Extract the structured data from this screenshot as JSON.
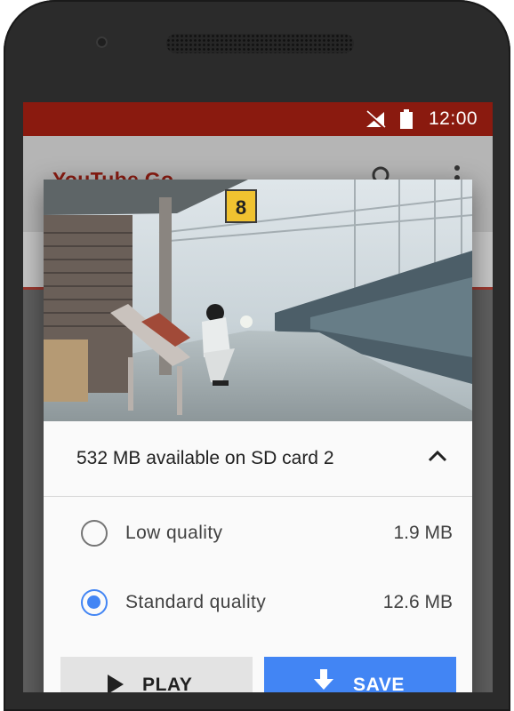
{
  "status_bar": {
    "time": "12:00",
    "icons": [
      "no-signal-icon",
      "battery-icon"
    ]
  },
  "app": {
    "title": "YouTube Go",
    "icons": [
      "search-icon",
      "more-vert-icon"
    ]
  },
  "dialog": {
    "storage_text": "532 MB available on SD card 2",
    "options": [
      {
        "label": "Low quality",
        "size": "1.9 MB",
        "selected": false
      },
      {
        "label": "Standard quality",
        "size": "12.6 MB",
        "selected": true
      }
    ],
    "buttons": {
      "play_label": "PLAY",
      "save_label": "SAVE"
    },
    "thumbnail_sign": "8"
  },
  "colors": {
    "status_bar": "#8a1a0f",
    "accent": "#4285f4",
    "brand_red": "#b12418"
  }
}
